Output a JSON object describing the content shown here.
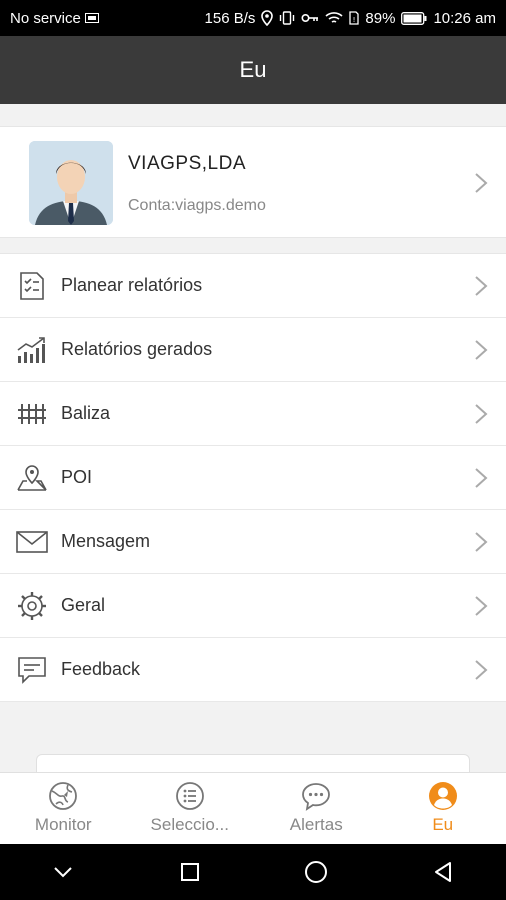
{
  "status_bar": {
    "carrier": "No service",
    "net_speed": "156 B/s",
    "battery_percent": "89%",
    "time": "10:26 am"
  },
  "header": {
    "title": "Eu"
  },
  "profile": {
    "name": "VIAGPS,LDA",
    "account": "Conta:viagps.demo"
  },
  "menu": {
    "items": [
      {
        "label": "Planear relatórios",
        "icon": "report-plan-icon"
      },
      {
        "label": "Relatórios gerados",
        "icon": "chart-trend-icon"
      },
      {
        "label": "Baliza",
        "icon": "fence-icon"
      },
      {
        "label": "POI",
        "icon": "poi-icon"
      },
      {
        "label": "Mensagem",
        "icon": "mail-icon"
      },
      {
        "label": "Geral",
        "icon": "gear-icon"
      },
      {
        "label": "Feedback",
        "icon": "feedback-icon"
      }
    ]
  },
  "tabs": [
    {
      "label": "Monitor",
      "icon": "globe-icon",
      "active": false
    },
    {
      "label": "Seleccio...",
      "icon": "list-icon",
      "active": false
    },
    {
      "label": "Alertas",
      "icon": "chat-icon",
      "active": false
    },
    {
      "label": "Eu",
      "icon": "user-icon",
      "active": true
    }
  ],
  "colors": {
    "accent": "#f08c1a",
    "header_bg": "#3a3a3a",
    "background": "#f2f2f2"
  }
}
